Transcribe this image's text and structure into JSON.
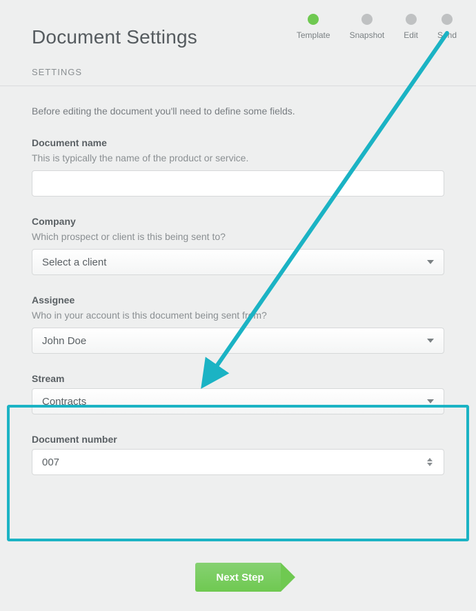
{
  "header": {
    "title": "Document Settings",
    "steps": [
      {
        "label": "Template",
        "active": true
      },
      {
        "label": "Snapshot",
        "active": false
      },
      {
        "label": "Edit",
        "active": false
      },
      {
        "label": "Send",
        "active": false
      }
    ]
  },
  "tabs": {
    "settings": "SETTINGS"
  },
  "intro": "Before editing the document you'll need to define some fields.",
  "fields": {
    "document_name": {
      "label": "Document name",
      "help": "This is typically the name of the product or service.",
      "value": ""
    },
    "company": {
      "label": "Company",
      "help": "Which prospect or client is this being sent to?",
      "placeholder": "Select a client"
    },
    "assignee": {
      "label": "Assignee",
      "help": "Who in your account is this document being sent from?",
      "value": "John Doe"
    },
    "stream": {
      "label": "Stream",
      "value": "Contracts"
    },
    "document_number": {
      "label": "Document number",
      "value": "007"
    }
  },
  "actions": {
    "next": "Next Step"
  },
  "annotation": {
    "highlight_color": "#1bb3c4"
  }
}
